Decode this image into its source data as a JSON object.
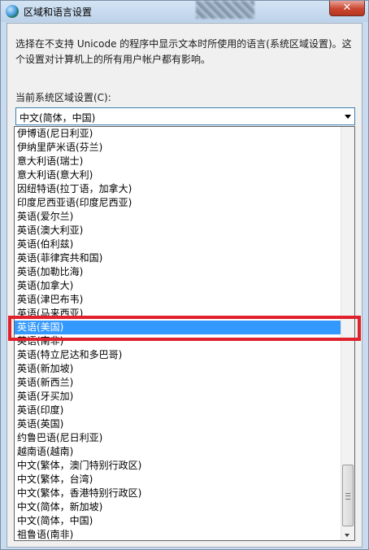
{
  "window": {
    "title": "区域和语言设置",
    "close_glyph": "✕"
  },
  "description": "选择在不支持 Unicode 的程序中显示文本时所使用的语言(系统区域设置)。这个设置对计算机上的所有用户帐户都有影响。",
  "locale": {
    "label": "当前系统区域设置(C):",
    "value": "中文(简体，中国)"
  },
  "dropdown": {
    "options": [
      "伊博语(尼日利亚)",
      "伊纳里萨米语(芬兰)",
      "意大利语(瑞士)",
      "意大利语(意大利)",
      "因纽特语(拉丁语，加拿大)",
      "印度尼西亚语(印度尼西亚)",
      "英语(爱尔兰)",
      "英语(澳大利亚)",
      "英语(伯利兹)",
      "英语(菲律宾共和国)",
      "英语(加勒比海)",
      "英语(加拿大)",
      "英语(津巴布韦)",
      "英语(马来西亚)",
      "英语(美国)",
      "英语(南非)",
      "英语(特立尼达和多巴哥)",
      "英语(新加坡)",
      "英语(新西兰)",
      "英语(牙买加)",
      "英语(印度)",
      "英语(英国)",
      "约鲁巴语(尼日利亚)",
      "越南语(越南)",
      "中文(繁体，澳门特别行政区)",
      "中文(繁体，台湾)",
      "中文(繁体，香港特别行政区)",
      "中文(简体，新加坡)",
      "中文(简体，中国)",
      "祖鲁语(南非)"
    ],
    "selected": "英语(美国)"
  }
}
